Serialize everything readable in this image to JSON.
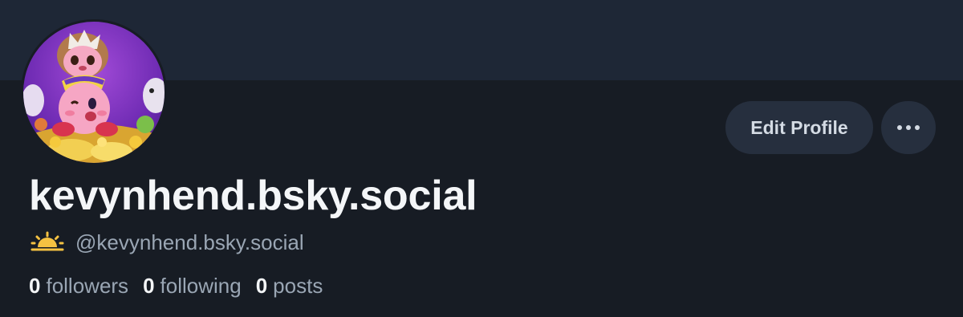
{
  "profile": {
    "display_name": "kevynhend.bsky.social",
    "handle": "@kevynhend.bsky.social",
    "handle_icon": "sunrise-icon",
    "avatar_icon": "avatar-image"
  },
  "actions": {
    "edit_label": "Edit Profile",
    "more_icon": "ellipsis-icon"
  },
  "stats": {
    "followers_count": "0",
    "followers_label": "followers",
    "following_count": "0",
    "following_label": "following",
    "posts_count": "0",
    "posts_label": "posts"
  },
  "colors": {
    "background": "#171c24",
    "banner": "#1e2736",
    "button_bg": "#262f3e",
    "text_primary": "#f4f6f8",
    "text_secondary": "#9aa6b4",
    "sunrise": "#f5c242"
  }
}
